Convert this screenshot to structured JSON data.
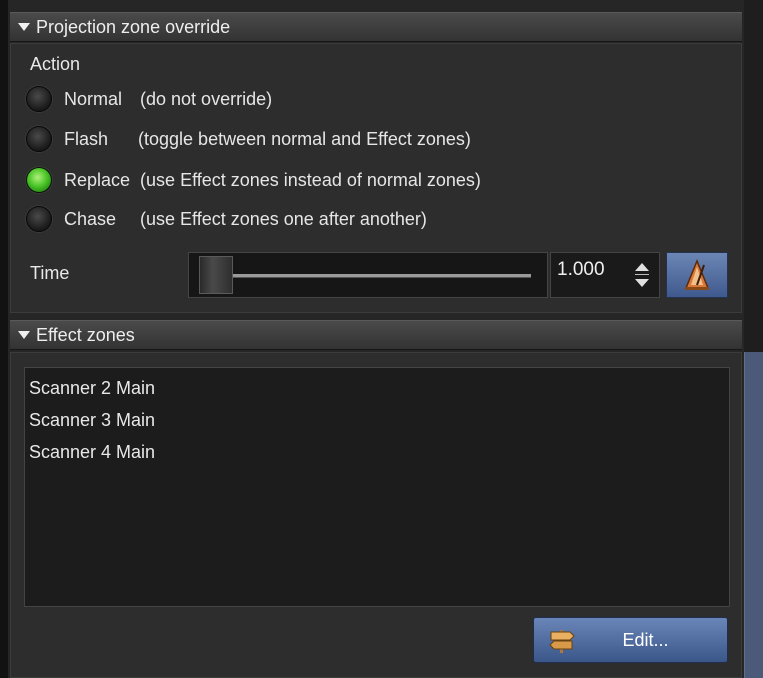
{
  "projection_section": {
    "title": "Projection zone  override",
    "action_label": "Action",
    "options": [
      {
        "label": "Normal",
        "hint": "(do not override)",
        "checked": false
      },
      {
        "label": "Flash",
        "hint": "(toggle between normal and Effect zones)",
        "checked": false
      },
      {
        "label": "Replace",
        "hint": "(use Effect zones instead of normal zones)",
        "checked": true
      },
      {
        "label": "Chase",
        "hint": "(use Effect zones one after another)",
        "checked": false
      }
    ],
    "time_label": "Time",
    "time_value": "1.000",
    "metronome_icon": "metronome-icon"
  },
  "effect_section": {
    "title": "Effect zones",
    "zones": [
      "Scanner 2 Main",
      "Scanner 3 Main",
      "Scanner 4 Main"
    ],
    "edit_button_label": "Edit...",
    "edit_icon": "signpost-icon"
  },
  "colors": {
    "accent_blue": "#4f6a9c",
    "radio_checked": "#46c224"
  }
}
